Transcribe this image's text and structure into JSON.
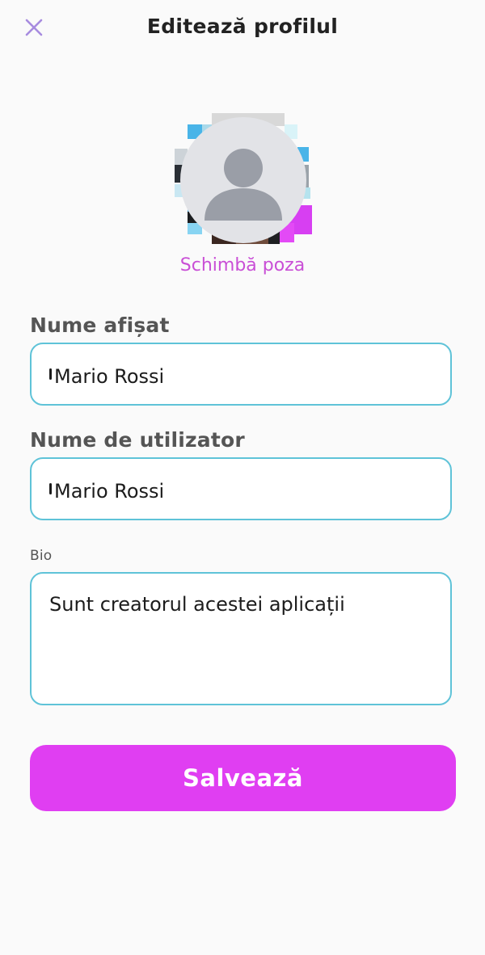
{
  "header": {
    "title": "Editează profilul",
    "close_icon": "close-icon"
  },
  "avatar": {
    "icon": "user-avatar-icon",
    "change_photo_label": "Schimbă poza"
  },
  "form": {
    "display_name": {
      "label": "Nume afișat",
      "value": "Mario Rossi"
    },
    "username": {
      "label": "Nume de utilizator",
      "value": "Mario Rossi"
    },
    "bio": {
      "label": "Bio",
      "value": "Sunt creatorul acestei aplicații"
    }
  },
  "actions": {
    "save_label": "Salvează"
  },
  "colors": {
    "accent": "#e03ef2",
    "link": "#c94fd6",
    "input_border": "#5fc3d8",
    "close_icon": "#a78bdf"
  }
}
